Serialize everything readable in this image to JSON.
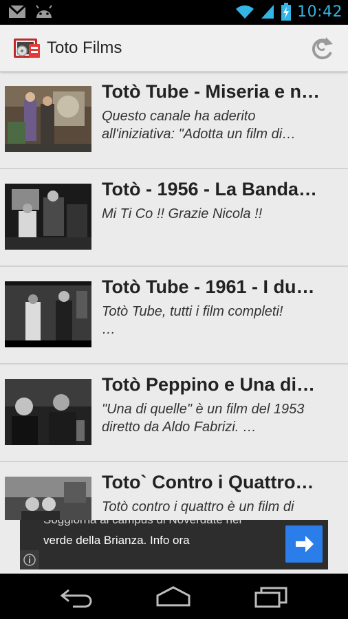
{
  "status_bar": {
    "time": "10:42",
    "icons": [
      "gmail-icon",
      "android-icon",
      "wifi-icon",
      "signal-icon",
      "battery-charging-icon"
    ]
  },
  "action_bar": {
    "title": "Toto Films",
    "app_icon": "film-reel-icon",
    "refresh_icon": "refresh-icon"
  },
  "list": {
    "items": [
      {
        "title": "Totò Tube - Miseria e n…",
        "description": "Questo canale ha aderito\nall'iniziativa: \"Adotta un film di…"
      },
      {
        "title": "Totò - 1956 - La Banda…",
        "description": "Mi Ti Co !! Grazie Nicola !!"
      },
      {
        "title": "Totò Tube -  1961 - I du…",
        "description": "Totò Tube, tutti i film completi!\n…"
      },
      {
        "title": "Totò Peppino e Una di…",
        "description": "\"Una di quelle\" è un film del 1953\ndiretto da Aldo Fabrizi.  …"
      },
      {
        "title": "Toto` Contro i Quattro…",
        "description": "Totò contro i quattro è un film di"
      }
    ]
  },
  "ad": {
    "text_top": "Soggiorna al campus di Noverdate nel",
    "text": "verde della Brianza. Info ora",
    "arrow_icon": "arrow-right-icon",
    "info_icon": "info-icon"
  },
  "nav_bar": {
    "back_icon": "back-icon",
    "home_icon": "home-icon",
    "recents_icon": "recents-icon"
  },
  "colors": {
    "accent": "#33b5e5",
    "action_bar_bg": "#f0f0f0",
    "list_bg": "#ebebeb",
    "ad_button": "#2b7de9"
  }
}
